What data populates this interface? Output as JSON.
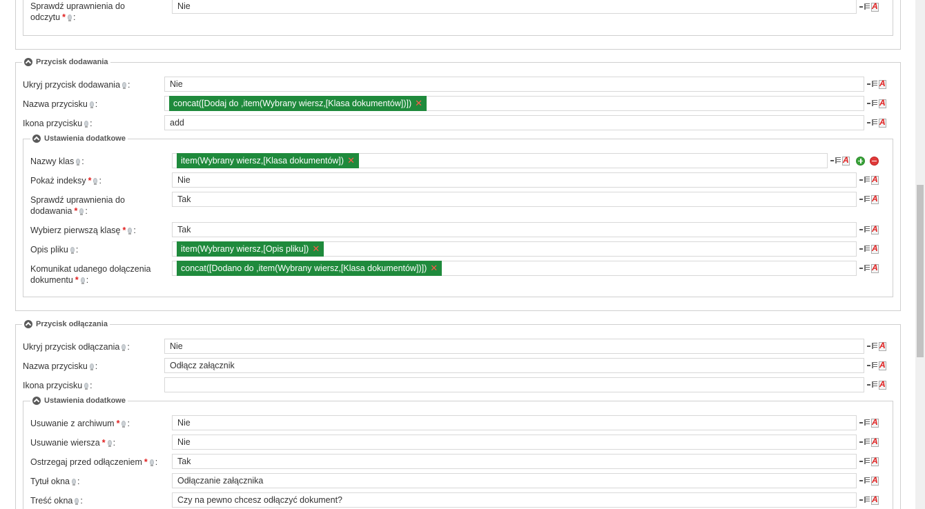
{
  "sections": {
    "top": {
      "check_read": {
        "label_l1": "Sprawdź uprawnienia do",
        "label_l2": "odczytu",
        "value": "Nie"
      }
    },
    "add_button": {
      "legend": "Przycisk dodawania",
      "hide": {
        "label": "Ukryj przycisk dodawania",
        "value": "Nie"
      },
      "name": {
        "label": "Nazwa przycisku",
        "tag": "concat([Dodaj do ,item(Wybrany wiersz,[Klasa dokumentów])])"
      },
      "icon": {
        "label": "Ikona przycisku",
        "value": "add"
      },
      "extra": {
        "legend": "Ustawienia dodatkowe",
        "class_names": {
          "label": "Nazwy klas",
          "tag": "item(Wybrany wiersz,[Klasa dokumentów])"
        },
        "show_index": {
          "label": "Pokaż indeksy",
          "value": "Nie"
        },
        "check_add": {
          "label_l1": "Sprawdź uprawnienia do",
          "label_l2": "dodawania",
          "value": "Tak"
        },
        "first_class": {
          "label": "Wybierz pierwszą klasę",
          "value": "Tak"
        },
        "file_desc": {
          "label": "Opis pliku",
          "tag": "item(Wybrany wiersz,[Opis pliku])"
        },
        "success_msg": {
          "label_l1": "Komunikat udanego dołączenia",
          "label_l2": "dokumentu",
          "tag": "concat([Dodano do ,item(Wybrany wiersz,[Klasa dokumentów])])"
        }
      }
    },
    "detach_button": {
      "legend": "Przycisk odłączania",
      "hide": {
        "label": "Ukryj przycisk odłączania",
        "value": "Nie"
      },
      "name": {
        "label": "Nazwa przycisku",
        "value": "Odłącz załącznik"
      },
      "icon": {
        "label": "Ikona przycisku",
        "value": ""
      },
      "extra": {
        "legend": "Ustawienia dodatkowe",
        "remove_archive": {
          "label": "Usuwanie z archiwum",
          "value": "Nie"
        },
        "remove_row": {
          "label": "Usuwanie wiersza",
          "value": "Nie"
        },
        "warn": {
          "label": "Ostrzegaj przed odłączeniem",
          "value": "Tak"
        },
        "window_title": {
          "label": "Tytuł okna",
          "value": "Odłączanie załącznika"
        },
        "window_content": {
          "label": "Treść okna",
          "value": "Czy na pewno chcesz odłączyć dokument?"
        }
      }
    }
  },
  "marks": {
    "required": "*",
    "colon": ":",
    "remove": "✕"
  },
  "icons": {
    "hint": "lightbulb-icon",
    "function": "function-list-icon",
    "clear": "clear-value-icon",
    "add": "plus-circle-icon",
    "remove": "minus-circle-icon",
    "collapse": "chevron-up-circle-icon"
  }
}
